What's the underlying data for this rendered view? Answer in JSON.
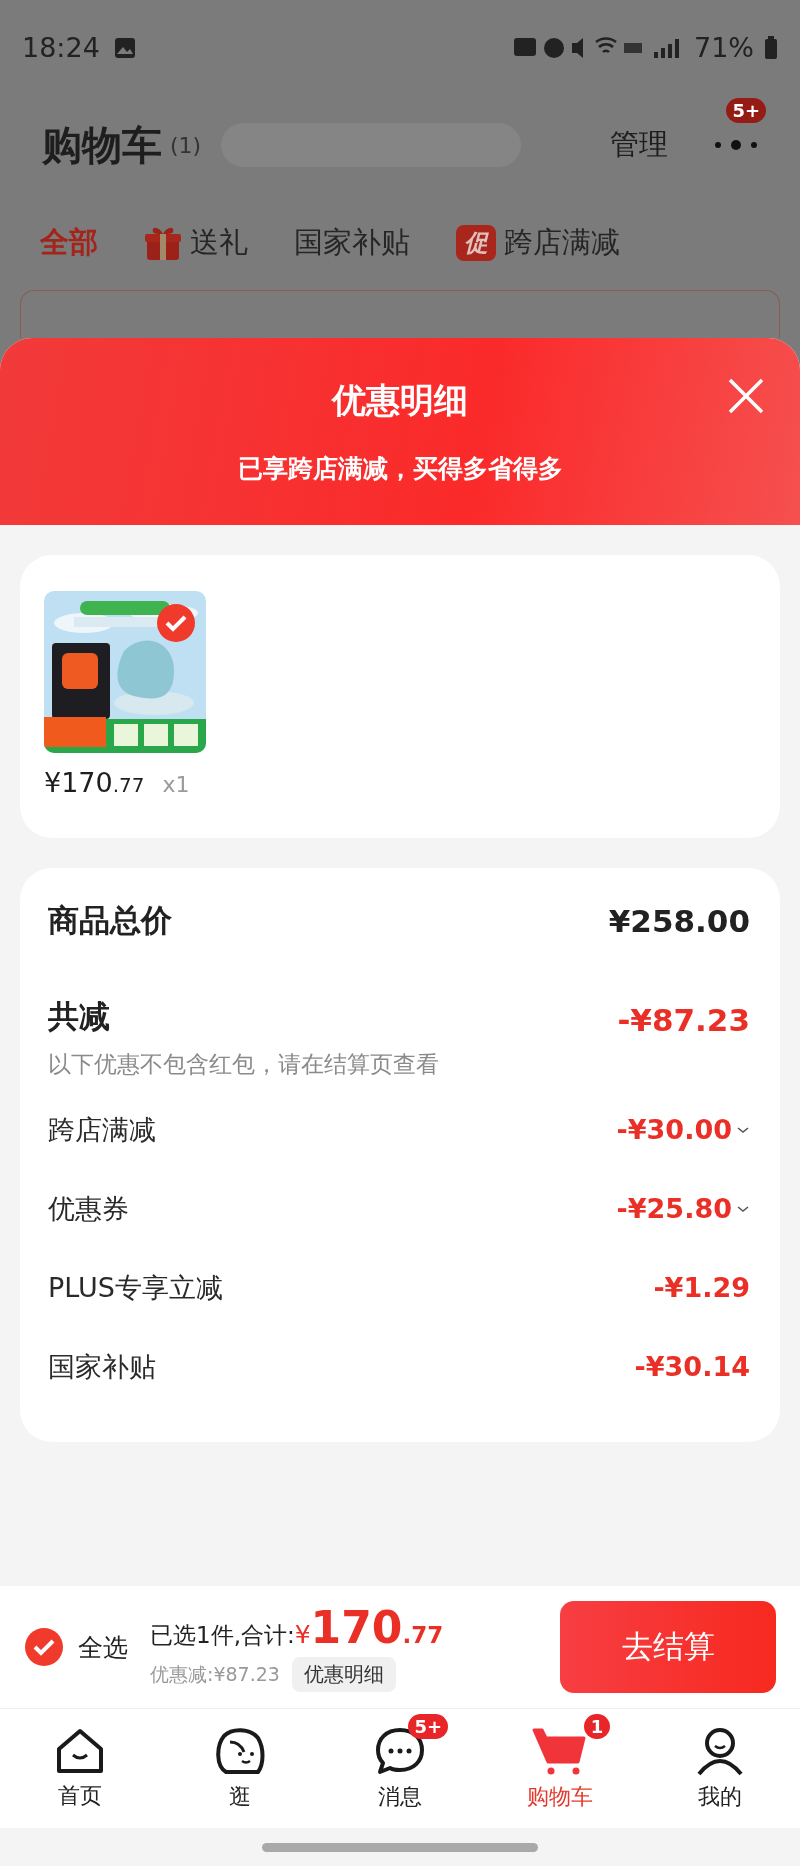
{
  "status_bar": {
    "time": "18:24",
    "battery": "71%"
  },
  "header": {
    "title": "购物车",
    "count": "(1)",
    "manage": "管理",
    "more_badge": "5+"
  },
  "filter_tabs": [
    {
      "kind": "plain",
      "label": "全部",
      "selected": true
    },
    {
      "kind": "gift",
      "label": "送礼",
      "selected": false
    },
    {
      "kind": "plain",
      "label": "国家补贴",
      "selected": false
    },
    {
      "kind": "promo",
      "badge": "促",
      "label": "跨店满减",
      "selected": false
    }
  ],
  "modal": {
    "title": "优惠明细",
    "subtitle": "已享跨店满减，买得多省得多",
    "items": [
      {
        "kind": "picture",
        "checked": true,
        "price": "¥170",
        "price_decimal": ".77",
        "quantity": "x1"
      }
    ],
    "summary": {
      "total_label": "商品总价",
      "total_value": "¥258.00",
      "discount_label": "共减",
      "discount_value": "-¥87.23",
      "note": "以下优惠不包含红包，请在结算页查看",
      "rows": [
        {
          "label": "跨店满减",
          "value": "-¥30.00",
          "expandable": true
        },
        {
          "label": "优惠券",
          "value": "-¥25.80",
          "expandable": true
        },
        {
          "label": "PLUS专享立减",
          "value": "-¥1.29",
          "expandable": false
        },
        {
          "label": "国家补贴",
          "value": "-¥30.14",
          "expandable": false
        }
      ]
    }
  },
  "checkout": {
    "select_all": {
      "label": "全选",
      "checked": true
    },
    "selected_text": "已选1件,合计:",
    "currency": "¥",
    "amount": "170",
    "decimal": ".77",
    "saved": "优惠减:¥87.23",
    "detail_button": "优惠明细",
    "submit": "去结算"
  },
  "nav": [
    {
      "kind": "home",
      "label": "首页",
      "selected": false
    },
    {
      "kind": "browse",
      "label": "逛",
      "selected": false
    },
    {
      "kind": "message",
      "label": "消息",
      "selected": false,
      "badge": "5+"
    },
    {
      "kind": "cart",
      "label": "购物车",
      "selected": true,
      "badge": "1"
    },
    {
      "kind": "profile",
      "label": "我的",
      "selected": false
    }
  ]
}
